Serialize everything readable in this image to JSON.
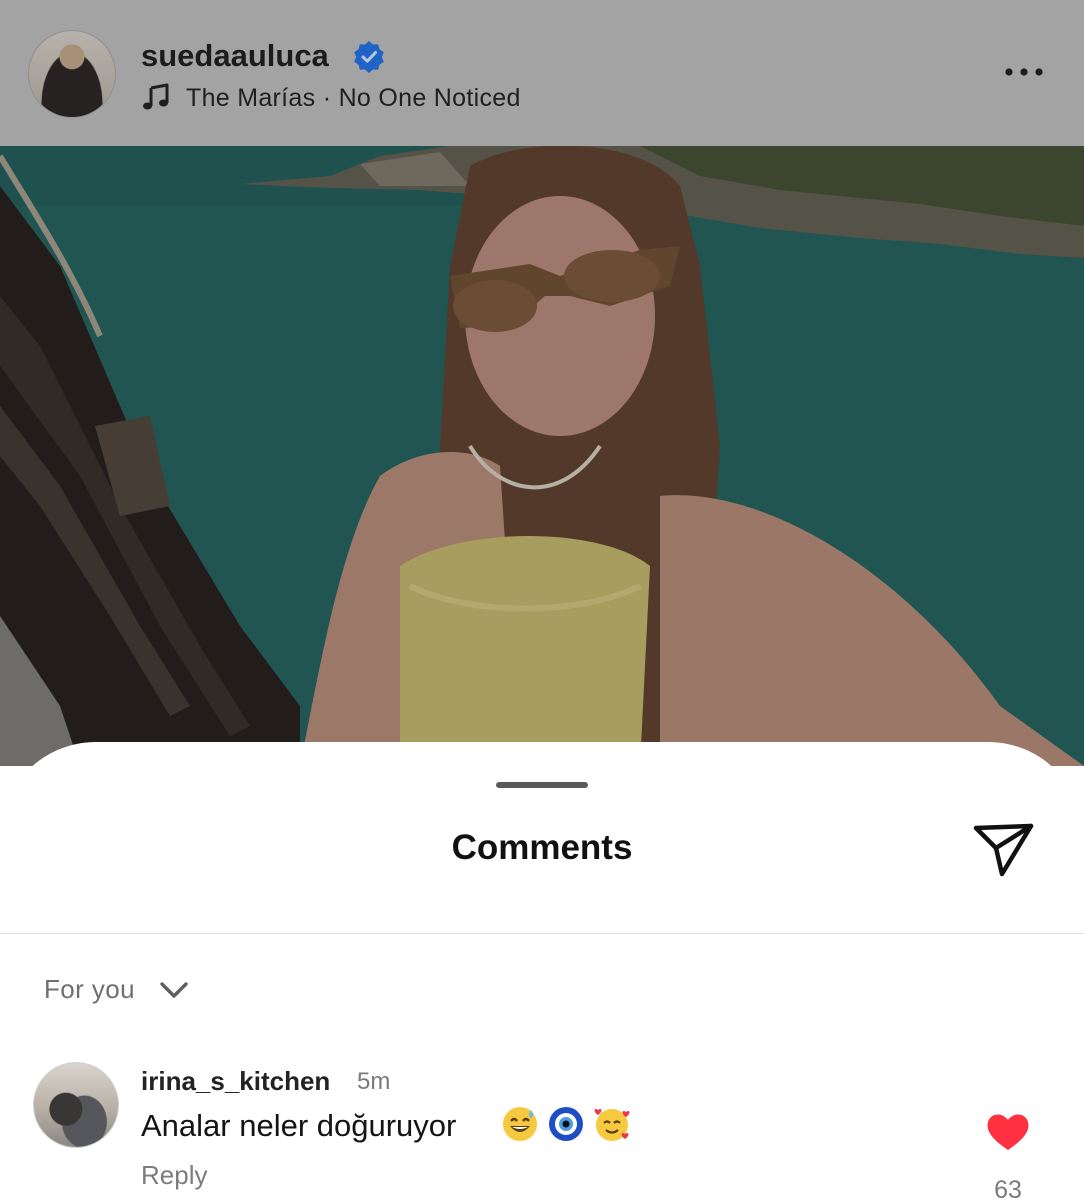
{
  "post": {
    "username": "suedaauluca",
    "verified": true,
    "music": {
      "artist": "The Marías",
      "separator": "·",
      "track": "No One Noticed"
    }
  },
  "sheet": {
    "title": "Comments",
    "filter_label": "For you"
  },
  "comments": [
    {
      "username": "irina_s_kitchen",
      "time": "5m",
      "text": "Analar neler doğuruyor",
      "emojis": [
        "sweat-smile-emoji",
        "nazar-amulet-emoji",
        "smiling-face-with-hearts-emoji"
      ],
      "reply_label": "Reply",
      "likes": "63",
      "liked": true
    }
  ],
  "colors": {
    "verified_blue": "#1f63c6",
    "like_red": "#ff3040",
    "dim_overlay": "#a3a3a3"
  },
  "icons": [
    "verified-icon",
    "music-note-icon",
    "more-icon",
    "share-icon",
    "chevron-down-icon",
    "heart-icon"
  ]
}
